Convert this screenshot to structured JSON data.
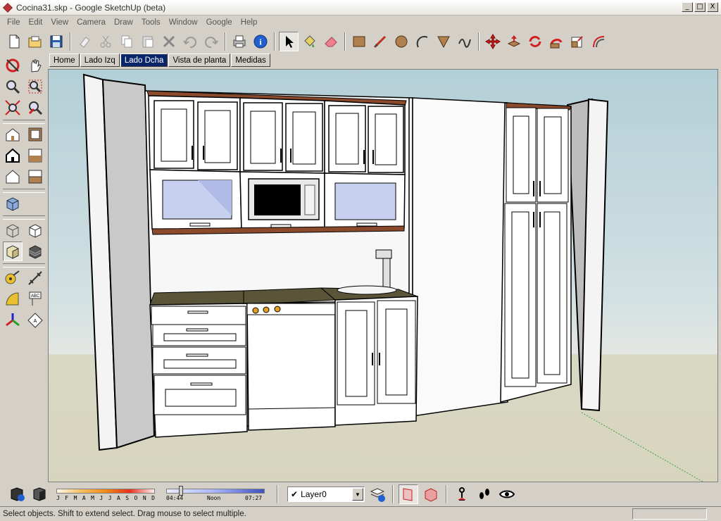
{
  "window": {
    "title": "Cocina31.skp - Google SketchUp (beta)",
    "buttons": [
      "_",
      "□",
      "X"
    ]
  },
  "menu": [
    "File",
    "Edit",
    "View",
    "Camera",
    "Draw",
    "Tools",
    "Window",
    "Google",
    "Help"
  ],
  "toolbar": {
    "standard": [
      "new-icon",
      "open-icon",
      "save-icon",
      "cut-icon",
      "copy-icon",
      "paste-icon",
      "erase-icon",
      "undo-icon",
      "redo-icon",
      "print-icon",
      "model-info-icon"
    ],
    "drawing": [
      "select-icon",
      "paint-bucket-icon",
      "eraser-icon",
      "rectangle-icon",
      "line-icon",
      "circle-icon",
      "arc-icon",
      "polygon-icon",
      "freehand-icon"
    ],
    "edit": [
      "move-icon",
      "push-pull-icon",
      "rotate-icon",
      "follow-me-icon",
      "scale-icon",
      "offset-icon"
    ]
  },
  "scene_tabs": [
    "Home",
    "Lado Izq",
    "Lado Dcha",
    "Vista de planta",
    "Medidas"
  ],
  "active_tab_index": 2,
  "shadow_settings": {
    "months": [
      "J",
      "F",
      "M",
      "A",
      "M",
      "J",
      "J",
      "A",
      "S",
      "O",
      "N",
      "D"
    ],
    "time_start": "04:44",
    "time_mid": "Noon",
    "time_end": "07:27"
  },
  "layer": {
    "current": "Layer0"
  },
  "status": {
    "message": "Select objects. Shift to extend select. Drag mouse to select multiple."
  },
  "colors": {
    "active_tab_bg": "#0a246a",
    "countertop": "#8b4a2b",
    "sky_top": "#b3cfd7",
    "ground": "#d7d5be",
    "glass": "#c8d0f0"
  }
}
